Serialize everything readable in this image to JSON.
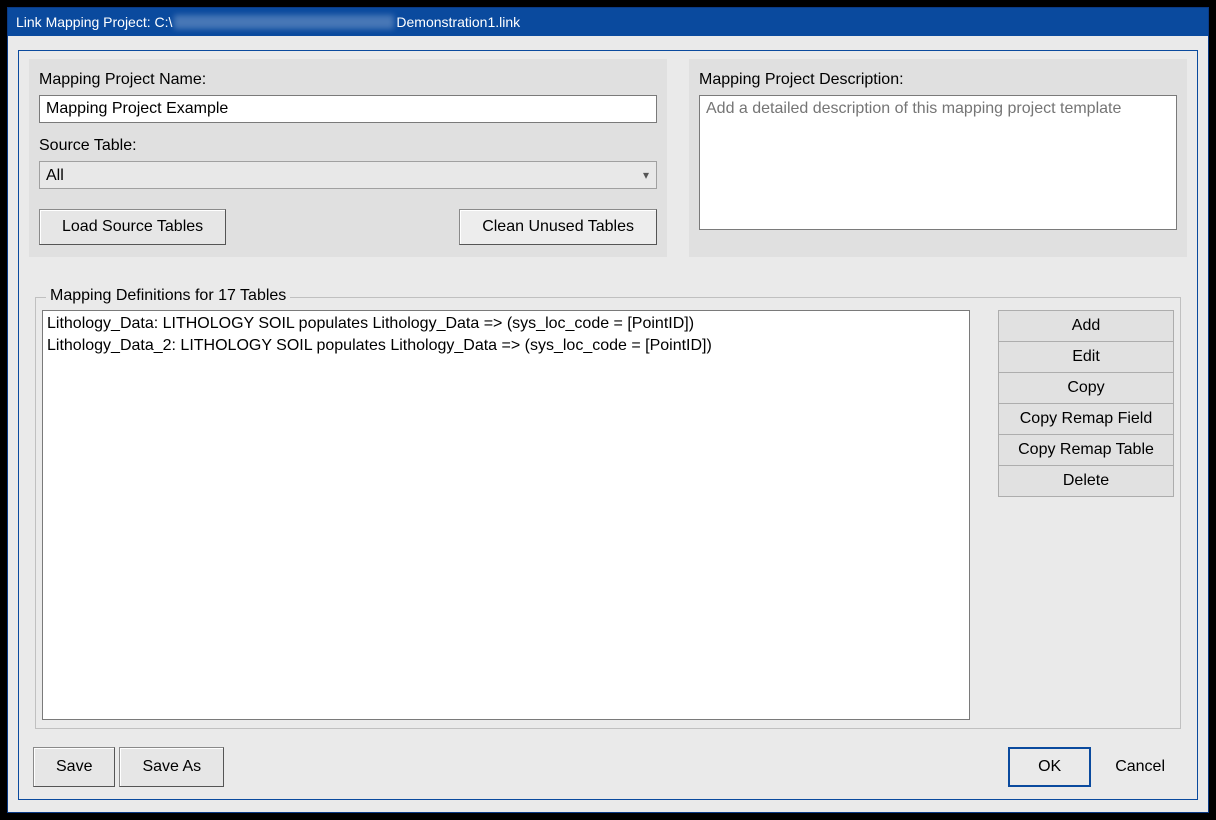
{
  "window": {
    "title_prefix": "Link Mapping Project: C:\\",
    "title_suffix": "Demonstration1.link"
  },
  "left_panel": {
    "name_label": "Mapping Project Name:",
    "name_value": "Mapping Project Example",
    "source_label": "Source Table:",
    "source_value": "All",
    "btn_load": "Load Source Tables",
    "btn_clean": "Clean Unused Tables"
  },
  "right_panel": {
    "desc_label": "Mapping Project Description:",
    "desc_placeholder": "Add a detailed description of this mapping project template"
  },
  "group": {
    "title": "Mapping Definitions for 17 Tables",
    "items": [
      "Lithology_Data: LITHOLOGY SOIL populates Lithology_Data => (sys_loc_code = [PointID])",
      "Lithology_Data_2: LITHOLOGY SOIL populates Lithology_Data => (sys_loc_code = [PointID])"
    ],
    "buttons": {
      "add": "Add",
      "edit": "Edit",
      "copy": "Copy",
      "copy_remap_field": "Copy Remap Field",
      "copy_remap_table": "Copy Remap Table",
      "delete": "Delete"
    }
  },
  "bottom": {
    "save": "Save",
    "save_as": "Save As",
    "ok": "OK",
    "cancel": "Cancel"
  }
}
